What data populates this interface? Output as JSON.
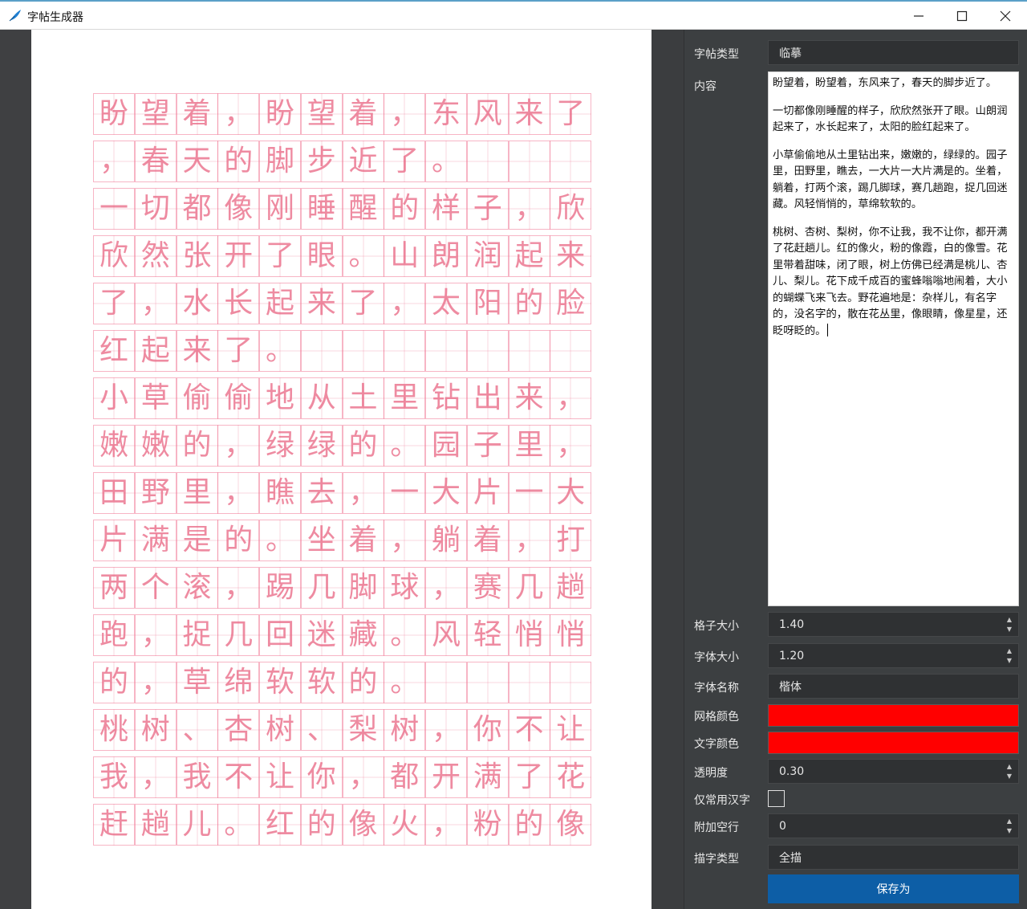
{
  "window": {
    "title": "字帖生成器",
    "controls": [
      "minimize-icon",
      "maximize-icon",
      "close-icon"
    ]
  },
  "preview": {
    "rows": [
      [
        "盼",
        "望",
        "着",
        "，",
        "盼",
        "望",
        "着",
        "，",
        "东",
        "风",
        "来",
        "了"
      ],
      [
        "，",
        "春",
        "天",
        "的",
        "脚",
        "步",
        "近",
        "了",
        "。",
        "",
        "",
        ""
      ],
      [
        "一",
        "切",
        "都",
        "像",
        "刚",
        "睡",
        "醒",
        "的",
        "样",
        "子",
        "，",
        "欣"
      ],
      [
        "欣",
        "然",
        "张",
        "开",
        "了",
        "眼",
        "。",
        "山",
        "朗",
        "润",
        "起",
        "来"
      ],
      [
        "了",
        "，",
        "水",
        "长",
        "起",
        "来",
        "了",
        "，",
        "太",
        "阳",
        "的",
        "脸"
      ],
      [
        "红",
        "起",
        "来",
        "了",
        "。",
        "",
        "",
        "",
        "",
        "",
        "",
        ""
      ],
      [
        "小",
        "草",
        "偷",
        "偷",
        "地",
        "从",
        "土",
        "里",
        "钻",
        "出",
        "来",
        "，"
      ],
      [
        "嫩",
        "嫩",
        "的",
        "，",
        "绿",
        "绿",
        "的",
        "。",
        "园",
        "子",
        "里",
        "，"
      ],
      [
        "田",
        "野",
        "里",
        "，",
        "瞧",
        "去",
        "，",
        "一",
        "大",
        "片",
        "一",
        "大"
      ],
      [
        "片",
        "满",
        "是",
        "的",
        "。",
        "坐",
        "着",
        "，",
        "躺",
        "着",
        "，",
        "打"
      ],
      [
        "两",
        "个",
        "滚",
        "，",
        "踢",
        "几",
        "脚",
        "球",
        "，",
        "赛",
        "几",
        "趟"
      ],
      [
        "跑",
        "，",
        "捉",
        "几",
        "回",
        "迷",
        "藏",
        "。",
        "风",
        "轻",
        "悄",
        "悄"
      ],
      [
        "的",
        "，",
        "草",
        "绵",
        "软",
        "软",
        "的",
        "。",
        "",
        "",
        "",
        ""
      ],
      [
        "桃",
        "树",
        "、",
        "杏",
        "树",
        "、",
        "梨",
        "树",
        "，",
        "你",
        "不",
        "让"
      ],
      [
        "我",
        "，",
        "我",
        "不",
        "让",
        "你",
        "，",
        "都",
        "开",
        "满",
        "了",
        "花"
      ],
      [
        "赶",
        "趟",
        "儿",
        "。",
        "红",
        "的",
        "像",
        "火",
        "，",
        "粉",
        "的",
        "像"
      ]
    ],
    "grid_color": "#ff0000",
    "text_color": "#ff0000"
  },
  "form": {
    "type_label": "字帖类型",
    "type_value": "临摹",
    "content_label": "内容",
    "content_paragraphs": [
      "盼望着，盼望着，东风来了，春天的脚步近了。",
      "一切都像刚睡醒的样子，欣欣然张开了眼。山朗润起来了，水长起来了，太阳的脸红起来了。",
      "小草偷偷地从土里钻出来，嫩嫩的，绿绿的。园子里，田野里，瞧去，一大片一大片满是的。坐着，躺着，打两个滚，踢几脚球，赛几趟跑，捉几回迷藏。风轻悄悄的，草绵软软的。",
      "桃树、杏树、梨树，你不让我，我不让你，都开满了花赶趟儿。红的像火，粉的像霞，白的像雪。花里带着甜味，闭了眼，树上仿佛已经满是桃儿、杏儿、梨儿。花下成千成百的蜜蜂嗡嗡地闹着，大小的蝴蝶飞来飞去。野花遍地是：杂样儿，有名字的，没名字的，散在花丛里，像眼睛，像星星，还眨呀眨的。"
    ],
    "grid_size_label": "格子大小",
    "grid_size_value": "1.40",
    "font_size_label": "字体大小",
    "font_size_value": "1.20",
    "font_name_label": "字体名称",
    "font_name_value": "楷体",
    "grid_color_label": "网格颜色",
    "text_color_label": "文字颜色",
    "opacity_label": "透明度",
    "opacity_value": "0.30",
    "common_only_label": "仅常用汉字",
    "common_only_checked": false,
    "extra_lines_label": "附加空行",
    "extra_lines_value": "0",
    "trace_type_label": "描字类型",
    "trace_type_value": "全描",
    "save_label": "保存为"
  }
}
